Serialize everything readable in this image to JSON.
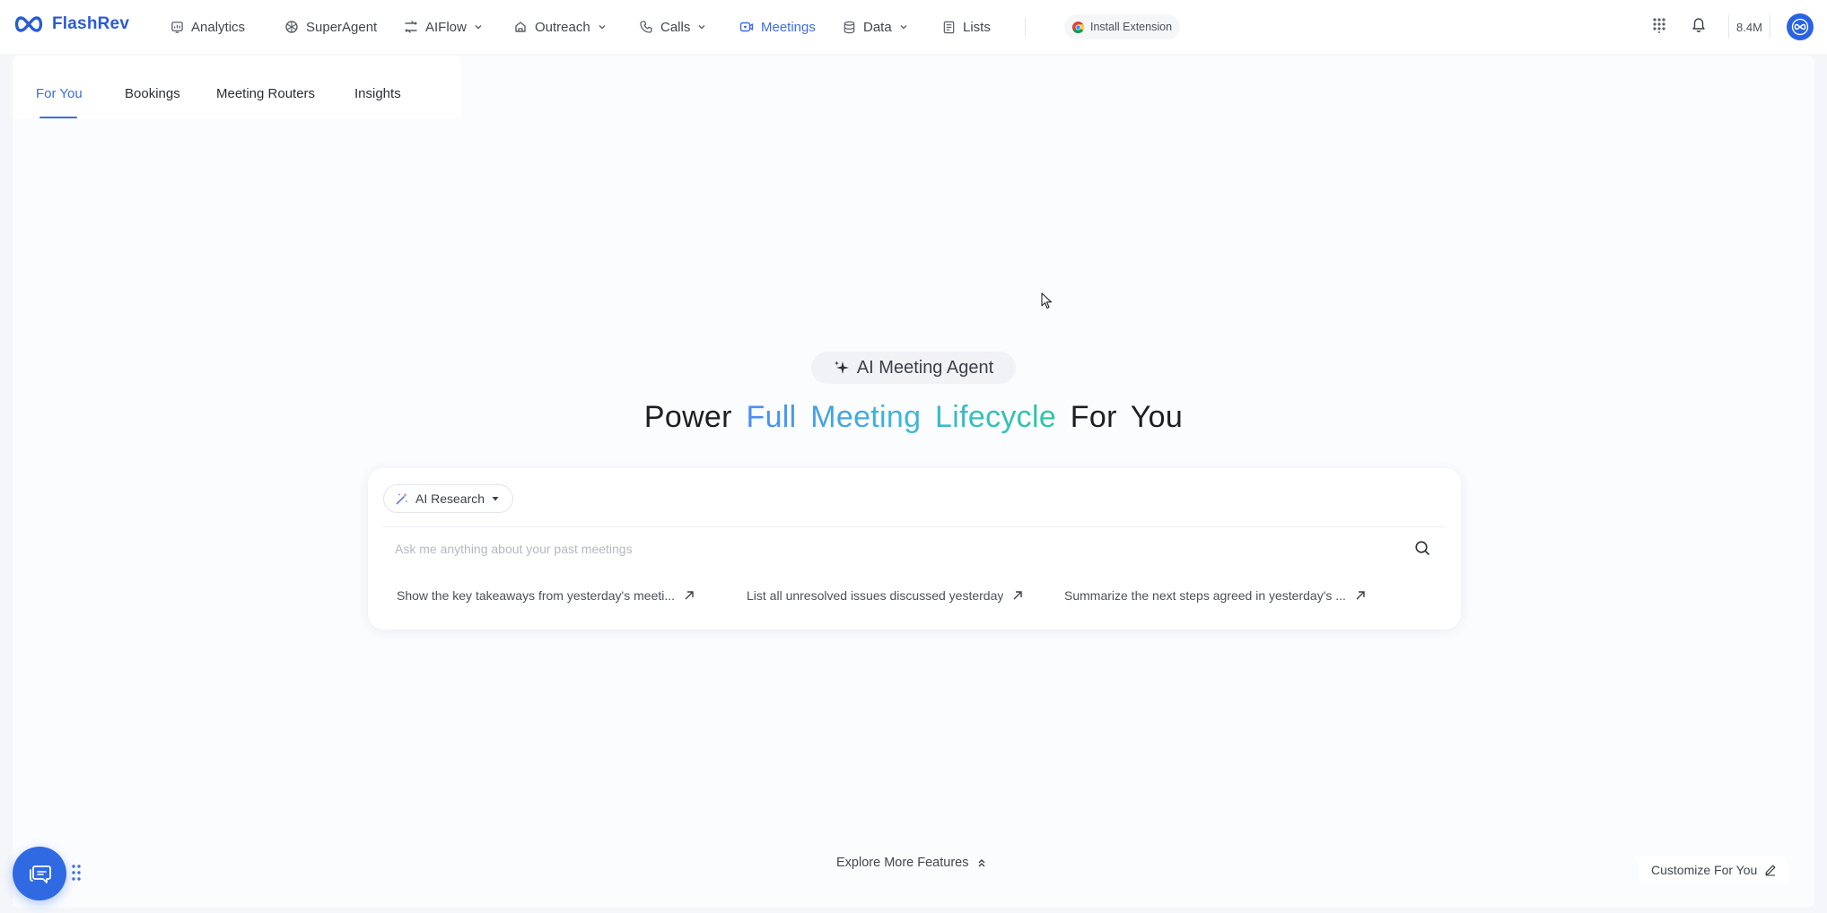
{
  "brand": {
    "name": "FlashRev",
    "color": "#2a5bd7"
  },
  "nav": {
    "analytics": "Analytics",
    "superagent": "SuperAgent",
    "aiflow": "AIFlow",
    "outreach": "Outreach",
    "calls": "Calls",
    "meetings": "Meetings",
    "data": "Data",
    "lists": "Lists",
    "active": "Meetings"
  },
  "install_extension": "Install Extension",
  "credits": "8.4M",
  "tabs": {
    "for_you": "For You",
    "bookings": "Bookings",
    "meeting_routers": "Meeting Routers",
    "insights": "Insights",
    "active": "For You"
  },
  "hero": {
    "badge": "AI Meeting Agent",
    "headline_prefix": "Power",
    "headline_highlight": "Full Meeting Lifecycle",
    "headline_suffix": "For You"
  },
  "search": {
    "mode": "AI Research",
    "placeholder": "Ask me anything about your past meetings",
    "value": ""
  },
  "suggestions": {
    "s1": "Show the key takeaways from yesterday's meeti...",
    "s2": "List all unresolved issues discussed yesterday",
    "s3": "Summarize the next steps agreed in yesterday's ..."
  },
  "footer": {
    "explore": "Explore More Features",
    "customize": "Customize For You"
  },
  "colors": {
    "accent": "#3d6de0",
    "gradient_start": "#4a8df5",
    "gradient_end": "#2cc6a3",
    "fab": "#2f6ae3"
  }
}
